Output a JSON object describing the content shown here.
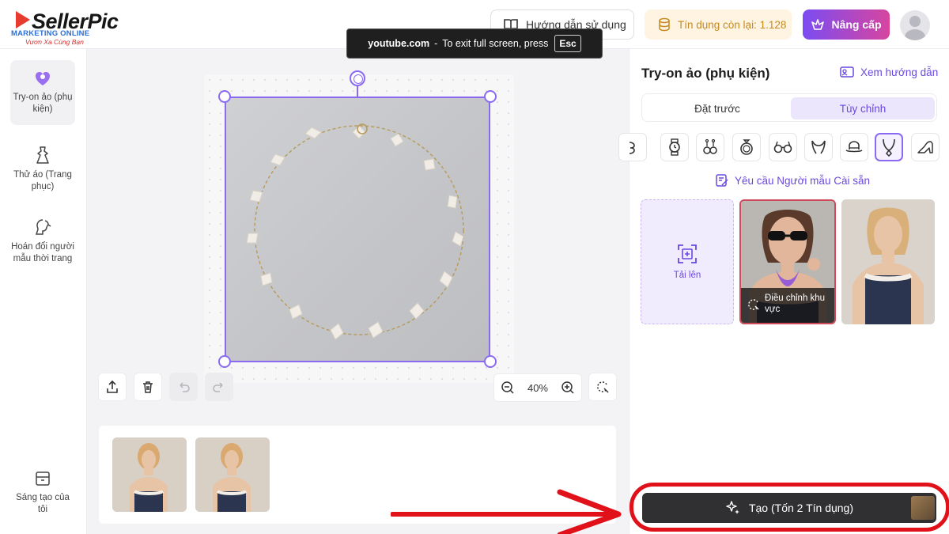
{
  "header": {
    "logo_text": "SellerPic",
    "logo_overlay": "",
    "logo_sub1": "MARKETING ONLINE",
    "logo_sub2": "Vươn Xa Cùng Bạn",
    "guide_label": "Hướng dẫn sử dụng",
    "credit_label": "Tín dụng còn lại: 1.128",
    "upgrade_label": "Nâng cấp"
  },
  "toast": {
    "site": "youtube.com",
    "separator": "-",
    "message": "To exit full screen, press",
    "key": "Esc"
  },
  "leftnav": {
    "items": [
      {
        "label": "Try-on ảo (phụ kiện)",
        "icon": "accessory-icon",
        "active": true
      },
      {
        "label": "Thử áo (Trang phục)",
        "icon": "dress-icon",
        "active": false
      },
      {
        "label": "Hoán đổi người mẫu thời trang",
        "icon": "model-swap-icon",
        "active": false
      }
    ],
    "bottom_item": {
      "label": "Sáng tạo của tôi",
      "icon": "archive-icon"
    }
  },
  "canvas": {
    "zoom": "40%",
    "thumbnails": 2
  },
  "panel": {
    "title": "Try-on ảo (phụ kiện)",
    "guide_link": "Xem hướng dẫn",
    "tabs": [
      {
        "label": "Đặt trước",
        "active": false
      },
      {
        "label": "Tùy chỉnh",
        "active": true
      }
    ],
    "accessories": [
      {
        "icon": "earring-partial-icon"
      },
      {
        "icon": "watch-icon"
      },
      {
        "icon": "drop-earrings-icon"
      },
      {
        "icon": "ring-icon"
      },
      {
        "icon": "glasses-icon"
      },
      {
        "icon": "headband-icon"
      },
      {
        "icon": "hat-icon"
      },
      {
        "icon": "necklace-icon",
        "active": true
      },
      {
        "icon": "heel-shoe-icon"
      }
    ],
    "request_link": "Yêu cầu Người mẫu Cài sẵn",
    "upload_label": "Tải lên",
    "adjust_label": "Điều chỉnh khu vực",
    "generate_label": "Tạo (Tốn 2 Tín dụng)"
  },
  "colors": {
    "accent": "#8a6af0",
    "accent_text": "#6a48e0",
    "highlight": "#e1111a"
  }
}
